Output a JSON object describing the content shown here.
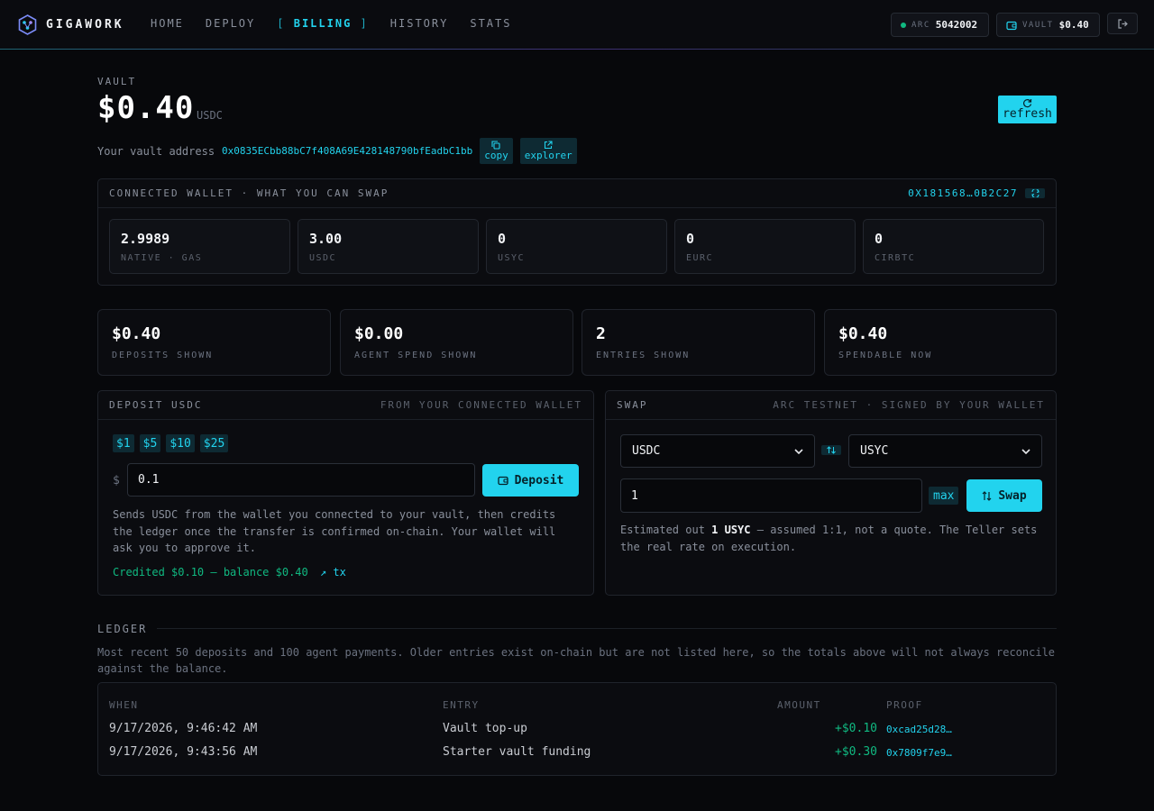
{
  "nav": {
    "brand": "GIGAWORK",
    "items": [
      {
        "label": "HOME"
      },
      {
        "label": "DEPLOY"
      },
      {
        "label": "BILLING",
        "active": true
      },
      {
        "label": "HISTORY"
      },
      {
        "label": "STATS"
      }
    ],
    "arc_label": "ARC",
    "arc_value": "5042002",
    "vault_label": "VAULT",
    "vault_value": "$0.40"
  },
  "vault": {
    "label": "VAULT",
    "amount": "$0.40",
    "unit": "USDC",
    "refresh_label": "refresh",
    "address_label": "Your vault address",
    "address": "0x0835ECbb88bC7f408A69E428148790bfEadbC1bb",
    "copy_label": "copy",
    "explorer_label": "explorer"
  },
  "wallet": {
    "title": "CONNECTED WALLET · WHAT YOU CAN SWAP",
    "address": "0X181568…0B2C27",
    "tokens": [
      {
        "value": "2.9989",
        "label": "NATIVE · GAS"
      },
      {
        "value": "3.00",
        "label": "USDC"
      },
      {
        "value": "0",
        "label": "USYC"
      },
      {
        "value": "0",
        "label": "EURC"
      },
      {
        "value": "0",
        "label": "CIRBTC"
      }
    ]
  },
  "stats": [
    {
      "value": "$0.40",
      "label": "DEPOSITS SHOWN"
    },
    {
      "value": "$0.00",
      "label": "AGENT SPEND SHOWN"
    },
    {
      "value": "2",
      "label": "ENTRIES SHOWN"
    },
    {
      "value": "$0.40",
      "label": "SPENDABLE NOW"
    }
  ],
  "deposit": {
    "title": "DEPOSIT USDC",
    "subtitle": "FROM YOUR CONNECTED WALLET",
    "presets": [
      "$1",
      "$5",
      "$10",
      "$25"
    ],
    "currency_symbol": "$",
    "amount": "0.1",
    "button_label": "Deposit",
    "help": "Sends USDC from the wallet you connected to your vault, then credits the ledger once the transfer is confirmed on-chain. Your wallet will ask you to approve it.",
    "credit_text": "Credited $0.10 — balance $0.40",
    "tx_label": "↗ tx"
  },
  "swap": {
    "title": "SWAP",
    "subtitle": "ARC TESTNET · SIGNED BY YOUR WALLET",
    "from": "USDC",
    "to": "USYC",
    "amount": "1",
    "max_label": "max",
    "button_label": "Swap",
    "estimate_prefix": "Estimated out",
    "estimate_value": "1 USYC",
    "estimate_suffix": "— assumed 1:1, not a quote. The Teller sets the real rate on execution."
  },
  "ledger": {
    "title": "LEDGER",
    "note": "Most recent 50 deposits and 100 agent payments. Older entries exist on-chain but are not listed here, so the totals above will not always reconcile against the balance.",
    "headers": {
      "when": "WHEN",
      "entry": "ENTRY",
      "amount": "AMOUNT",
      "proof": "PROOF"
    },
    "rows": [
      {
        "when": "9/17/2026, 9:46:42 AM",
        "entry": "Vault top-up",
        "amount": "+$0.10",
        "proof": "0xcad25d28…"
      },
      {
        "when": "9/17/2026, 9:43:56 AM",
        "entry": "Starter vault funding",
        "amount": "+$0.30",
        "proof": "0x7809f7e9…"
      }
    ]
  },
  "colors": {
    "accent": "#22d3ee",
    "positive": "#10b981",
    "background": "#07080b"
  }
}
